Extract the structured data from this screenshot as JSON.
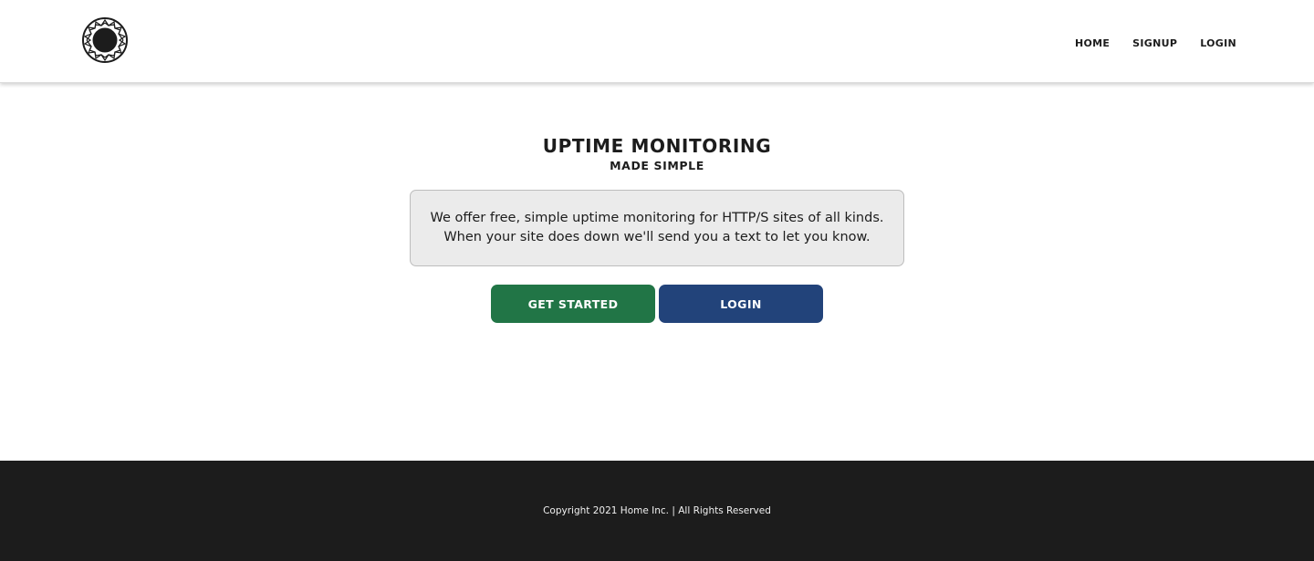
{
  "header": {
    "logo_icon": "sunburst-circle-logo",
    "nav": [
      {
        "label": "HOME"
      },
      {
        "label": "SIGNUP"
      },
      {
        "label": "LOGIN"
      }
    ]
  },
  "hero": {
    "title": "UPTIME MONITORING",
    "subtitle": "MADE SIMPLE",
    "description_line1": "We offer free, simple uptime monitoring for HTTP/S sites of all kinds.",
    "description_line2": "When your site does down we'll send you a text to let you know.",
    "get_started_label": "GET STARTED",
    "login_label": "LOGIN"
  },
  "footer": {
    "copyright": "Copyright 2021 Home Inc. | All Rights Reserved"
  },
  "colors": {
    "get_started": "#217546",
    "login": "#22437a",
    "footer_bg": "#1c1c1c",
    "info_box_bg": "#ebebeb"
  }
}
